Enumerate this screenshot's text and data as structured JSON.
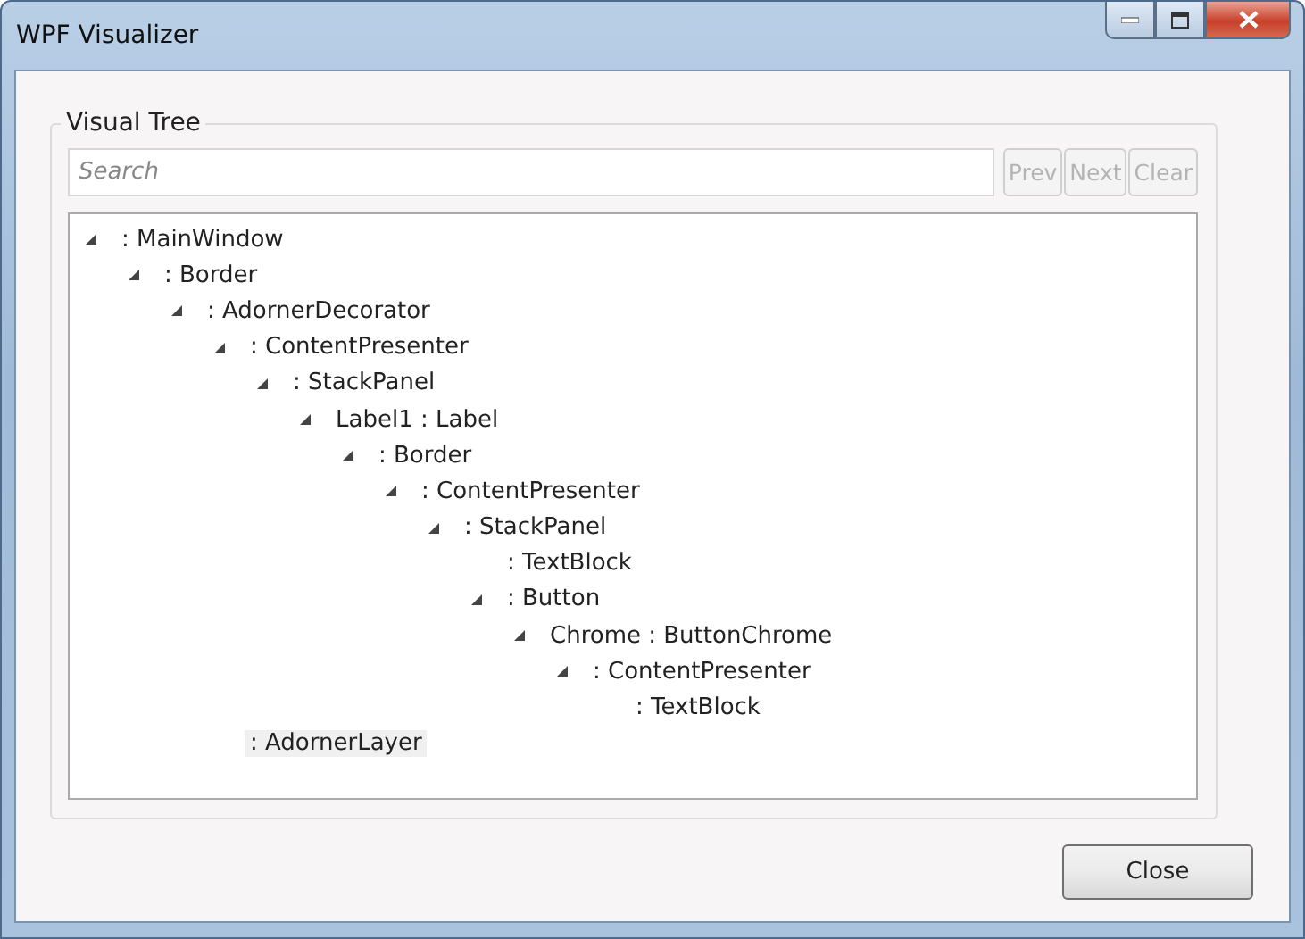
{
  "window": {
    "title": "WPF Visualizer"
  },
  "group": {
    "title": "Visual Tree"
  },
  "search": {
    "placeholder": "Search"
  },
  "search_buttons": [
    {
      "label": "Prev",
      "disabled": true
    },
    {
      "label": "Next",
      "disabled": true
    },
    {
      "label": "Clear",
      "disabled": true
    }
  ],
  "tree": [
    {
      "label": ": MainWindow",
      "expanded": true,
      "selected": false,
      "children": [
        {
          "label": ": Border",
          "expanded": true,
          "selected": false,
          "children": [
            {
              "label": ": AdornerDecorator",
              "expanded": true,
              "selected": false,
              "children": [
                {
                  "label": ": ContentPresenter",
                  "expanded": true,
                  "selected": false,
                  "children": [
                    {
                      "label": ": StackPanel",
                      "expanded": true,
                      "selected": false,
                      "children": [
                        {
                          "label": "Label1 : Label",
                          "expanded": true,
                          "selected": false,
                          "children": [
                            {
                              "label": ": Border",
                              "expanded": true,
                              "selected": false,
                              "children": [
                                {
                                  "label": ": ContentPresenter",
                                  "expanded": true,
                                  "selected": false,
                                  "children": [
                                    {
                                      "label": ": StackPanel",
                                      "expanded": true,
                                      "selected": false,
                                      "children": [
                                        {
                                          "label": ": TextBlock",
                                          "selected": false
                                        },
                                        {
                                          "label": ": Button",
                                          "expanded": true,
                                          "selected": false,
                                          "children": [
                                            {
                                              "label": "Chrome : ButtonChrome",
                                              "expanded": true,
                                              "selected": false,
                                              "children": [
                                                {
                                                  "label": ": ContentPresenter",
                                                  "expanded": true,
                                                  "selected": false,
                                                  "children": [
                                                    {
                                                      "label": ": TextBlock",
                                                      "selected": false
                                                    }
                                                  ]
                                                }
                                              ]
                                            }
                                          ]
                                        }
                                      ]
                                    }
                                  ]
                                }
                              ]
                            }
                          ]
                        }
                      ]
                    }
                  ]
                },
                {
                  "label": ": AdornerLayer",
                  "selected": true
                }
              ]
            }
          ]
        }
      ]
    }
  ],
  "buttons": [
    {
      "label": "Close"
    }
  ]
}
